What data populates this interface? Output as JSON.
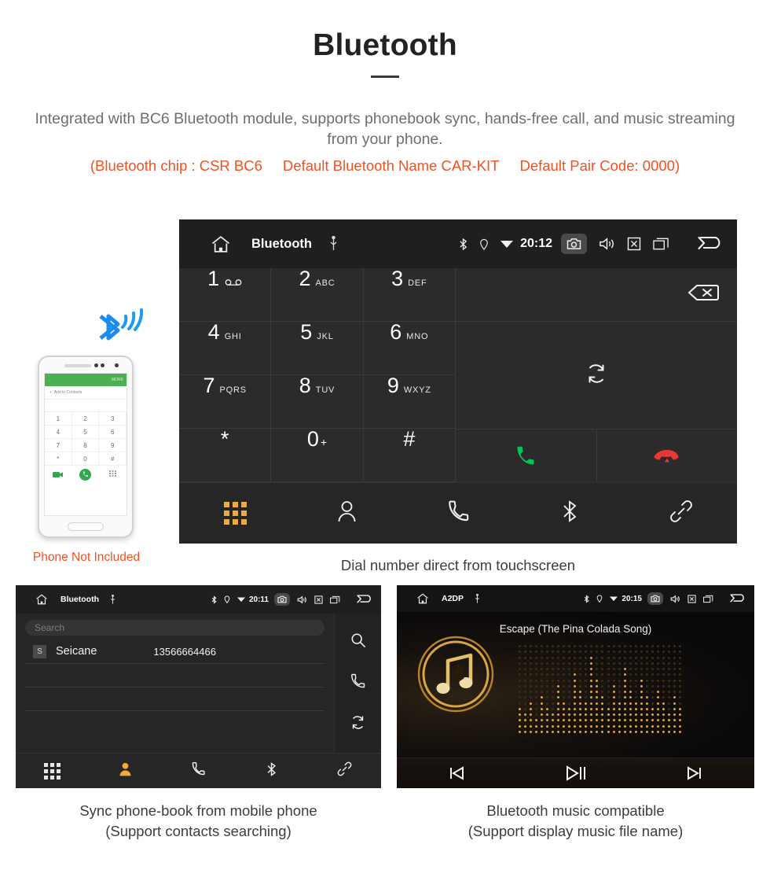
{
  "header": {
    "title": "Bluetooth",
    "description": "Integrated with BC6 Bluetooth module, supports phonebook sync, hands-free call, and music streaming from your phone.",
    "spec_chip": "(Bluetooth chip : CSR BC6",
    "spec_name": "Default Bluetooth Name CAR-KIT",
    "spec_pair": "Default Pair Code: 0000)"
  },
  "dialer": {
    "statusbar": {
      "home_icon": "home-icon",
      "title": "Bluetooth",
      "usb_icon": "usb-icon",
      "bluetooth_icon": "bluetooth-icon",
      "location_icon": "location-icon",
      "wifi_icon": "wifi-icon",
      "time": "20:12",
      "camera_icon": "camera-icon",
      "volume_icon": "speaker-icon",
      "close_icon": "close-box-icon",
      "recents_icon": "recent-apps-icon",
      "back_icon": "back-arrow-icon"
    },
    "keys": [
      {
        "num": "1",
        "sub": "",
        "voicemail": true
      },
      {
        "num": "2",
        "sub": "ABC"
      },
      {
        "num": "3",
        "sub": "DEF"
      },
      {
        "num": "4",
        "sub": "GHI"
      },
      {
        "num": "5",
        "sub": "JKL"
      },
      {
        "num": "6",
        "sub": "MNO"
      },
      {
        "num": "7",
        "sub": "PQRS"
      },
      {
        "num": "8",
        "sub": "TUV"
      },
      {
        "num": "9",
        "sub": "WXYZ"
      },
      {
        "num": "*",
        "sub": ""
      },
      {
        "num": "0",
        "sup": "+"
      },
      {
        "num": "#",
        "sub": ""
      }
    ],
    "number_display": "",
    "backspace_icon": "backspace-icon",
    "sync_icon": "sync-icon",
    "call_icon": "call-green-icon",
    "hangup_icon": "hangup-red-icon",
    "navbar": [
      {
        "icon": "dialpad-icon",
        "active": true
      },
      {
        "icon": "contacts-icon",
        "active": false
      },
      {
        "icon": "call-history-icon",
        "active": false
      },
      {
        "icon": "bluetooth-icon",
        "active": false
      },
      {
        "icon": "pair-link-icon",
        "active": false
      }
    ],
    "caption": "Dial number direct from touchscreen"
  },
  "phone_mockup": {
    "header_back_icon": "back-arrow-icon",
    "header_more": "MORE",
    "add_contact_label": "Add to Contacts",
    "keys": [
      "1",
      "2",
      "3",
      "4",
      "5",
      "6",
      "7",
      "8",
      "9",
      "*",
      "0",
      "#"
    ],
    "call_icon": "call-green-icon",
    "video_icon": "video-call-icon",
    "keypad_icon": "keypad-icon",
    "not_included_label": "Phone Not Included",
    "bluetooth_wave_icon": "bluetooth-signal-icon"
  },
  "contacts": {
    "statusbar": {
      "home_icon": "home-icon",
      "title": "Bluetooth",
      "usb_icon": "usb-icon",
      "time": "20:11",
      "camera_icon": "camera-icon",
      "volume_icon": "speaker-icon",
      "close_icon": "close-box-icon",
      "recents_icon": "recent-apps-icon",
      "back_icon": "back-arrow-icon"
    },
    "search_placeholder": "Search",
    "search_value": "",
    "rows": [
      {
        "badge": "S",
        "name": "Seicane",
        "number": "13566664466"
      }
    ],
    "side_icons": [
      "search-icon",
      "call-history-icon",
      "sync-icon"
    ],
    "navbar": [
      {
        "icon": "dialpad-icon",
        "active": false
      },
      {
        "icon": "contacts-icon",
        "active": true
      },
      {
        "icon": "call-history-icon",
        "active": false
      },
      {
        "icon": "bluetooth-icon",
        "active": false
      },
      {
        "icon": "pair-link-icon",
        "active": false
      }
    ],
    "caption_line1": "Sync phone-book from mobile phone",
    "caption_line2": "(Support contacts searching)"
  },
  "music": {
    "statusbar": {
      "home_icon": "home-icon",
      "title": "A2DP",
      "usb_icon": "usb-icon",
      "time": "20:15",
      "camera_icon": "camera-icon",
      "volume_icon": "speaker-icon",
      "close_icon": "close-box-icon",
      "recents_icon": "recent-apps-icon",
      "back_icon": "back-arrow-icon"
    },
    "song_title": "Escape (The Pina Colada Song)",
    "album_art_icon": "music-note-bluetooth-icon",
    "controls": [
      {
        "icon": "previous-track-icon"
      },
      {
        "icon": "play-pause-icon"
      },
      {
        "icon": "next-track-icon"
      }
    ],
    "caption_line1": "Bluetooth music compatible",
    "caption_line2": "(Support display music file name)"
  },
  "colors": {
    "accent_orange": "#f4511e",
    "active_amber": "#f0a93b",
    "call_green": "#00c853",
    "hangup_red": "#e53935",
    "panel_bg": "#262626",
    "gold": "#d9a441"
  }
}
